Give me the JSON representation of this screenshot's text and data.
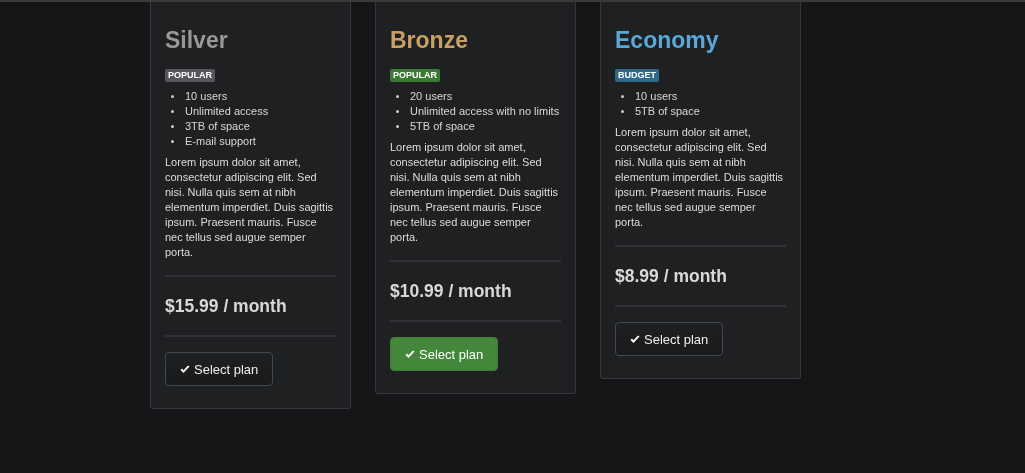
{
  "plans": [
    {
      "name": "Silver",
      "color": "#9a9894",
      "tag": {
        "label": "POPULAR",
        "color": "#55575a"
      },
      "features": [
        "10 users",
        "Unlimited access",
        "3TB of space",
        "E-mail support"
      ],
      "description": "Lorem ipsum dolor sit amet, consectetur adipiscing elit. Sed nisi. Nulla quis sem at nibh elementum imperdiet. Duis sagittis ipsum. Praesent mauris. Fusce nec tellus sed augue semper porta.",
      "price": "$15.99 / month",
      "button": {
        "label": "Select plan",
        "kind": "default"
      }
    },
    {
      "name": "Bronze",
      "color": "#c9a162",
      "tag": {
        "label": "POPULAR",
        "color": "#3a7a32"
      },
      "features": [
        "20 users",
        "Unlimited access with no limits",
        "5TB of space"
      ],
      "description": "Lorem ipsum dolor sit amet, consectetur adipiscing elit. Sed nisi. Nulla quis sem at nibh elementum imperdiet. Duis sagittis ipsum. Praesent mauris. Fusce nec tellus sed augue semper porta.",
      "price": "$10.99 / month",
      "button": {
        "label": "Select plan",
        "kind": "primary"
      }
    },
    {
      "name": "Economy",
      "color": "#5aa8d8",
      "tag": {
        "label": "BUDGET",
        "color": "#2d6a8a"
      },
      "features": [
        "10 users",
        "5TB of space"
      ],
      "description": "Lorem ipsum dolor sit amet, consectetur adipiscing elit. Sed nisi. Nulla quis sem at nibh elementum imperdiet. Duis sagittis ipsum. Praesent mauris. Fusce nec tellus sed augue semper porta.",
      "price": "$8.99 / month",
      "button": {
        "label": "Select plan",
        "kind": "default"
      }
    }
  ]
}
